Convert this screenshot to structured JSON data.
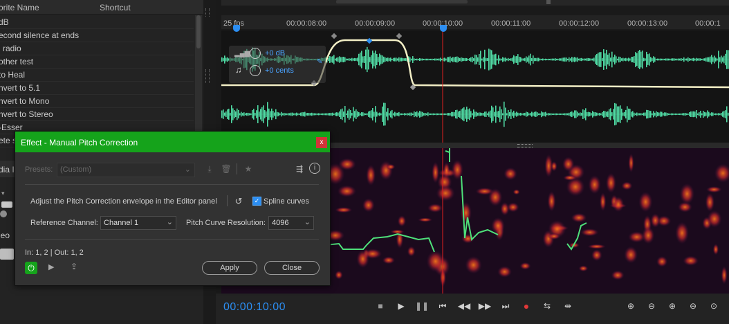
{
  "favorites": {
    "col_name": "orite Name",
    "col_shortcut": "Shortcut",
    "items": [
      "dB",
      "econd silence at ends",
      "l radio",
      "other test",
      "to Heal",
      "nvert to 5.1",
      "nvert to Mono",
      "nvert to Stereo",
      "-Esser",
      "ete s"
    ]
  },
  "left_partial": {
    "media_tab": "dia I",
    "video_label": "leo"
  },
  "timeline": {
    "fps": "25 fps",
    "ticks": [
      "00:00:08:00",
      "00:00:09:00",
      "00:00:10:00",
      "00:00:11:00",
      "00:00:12:00",
      "00:00:13:00",
      "00:00:1"
    ]
  },
  "clip": {
    "volume": "+0 dB",
    "pitch": "+0 cents"
  },
  "transport": {
    "time": "00:00:10:00"
  },
  "dialog": {
    "title": "Effect - Manual Pitch Correction",
    "close": "x",
    "presets_label": "Presets:",
    "presets_value": "(Custom)",
    "adjust_text": "Adjust the Pitch Correction envelope in the Editor panel",
    "spline_label": "Spline curves",
    "spline_checked": true,
    "ref_channel_label": "Reference Channel:",
    "ref_channel_value": "Channel 1",
    "resolution_label": "Pitch Curve Resolution:",
    "resolution_value": "4096",
    "io_text": "In: 1, 2 | Out: 1, 2",
    "apply": "Apply",
    "close_button": "Close"
  },
  "colors": {
    "accent_green": "#15a31b",
    "time_blue": "#2c8ef2",
    "waveform": "#4fd9a3",
    "playhead": "#e02020"
  }
}
